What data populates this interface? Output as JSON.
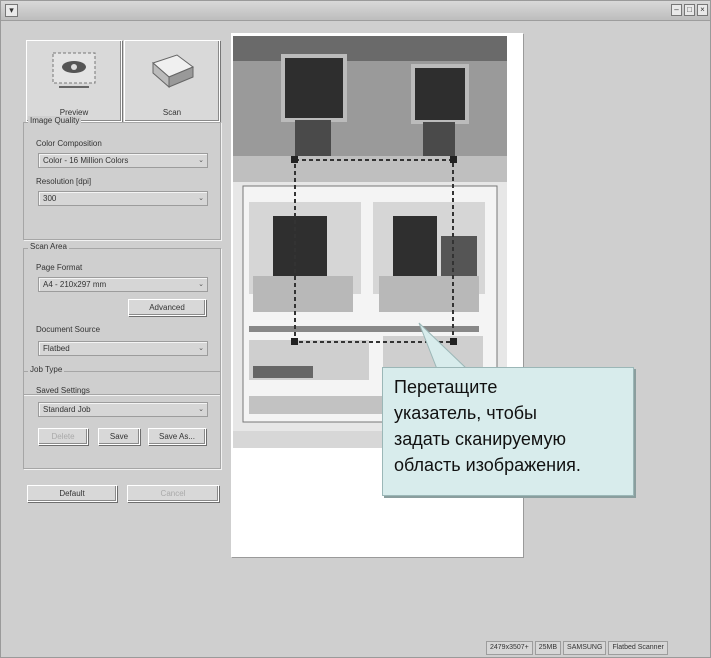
{
  "window": {
    "sysmenu_glyph": "▾",
    "buttons": [
      "–",
      "□",
      "×"
    ]
  },
  "toolbar": {
    "preview_label": "Preview",
    "scan_label": "Scan"
  },
  "image_quality": {
    "legend": "Image Quality",
    "color_label": "Color Composition",
    "color_value": "Color - 16 Million Colors",
    "resolution_label": "Resolution [dpi]",
    "resolution_value": "300"
  },
  "scan_area": {
    "legend": "Scan Area",
    "page_format_label": "Page Format",
    "page_format_value": "A4 - 210x297 mm",
    "advanced_label": "Advanced",
    "document_source_label": "Document Source",
    "document_source_value": "Flatbed"
  },
  "job_type": {
    "legend": "Job Type",
    "saved_label": "Saved Settings",
    "saved_value": "Standard Job",
    "delete_label": "Delete",
    "save_label": "Save",
    "save_as_label": "Save As..."
  },
  "footer_buttons": {
    "default_label": "Default",
    "cancel_label": "Cancel"
  },
  "status": {
    "size": "2479x3507+",
    "bits": "25MB",
    "device": "SAMSUNG",
    "scanner": "Flatbed Scanner"
  },
  "tooltip": {
    "line1": "Перетащите",
    "line2": "указатель, чтобы",
    "line3": "задать сканируемую",
    "line4": "область изображения."
  },
  "colors": {
    "window_bg": "#cfcfcf",
    "tooltip_bg": "#d8ecec"
  }
}
